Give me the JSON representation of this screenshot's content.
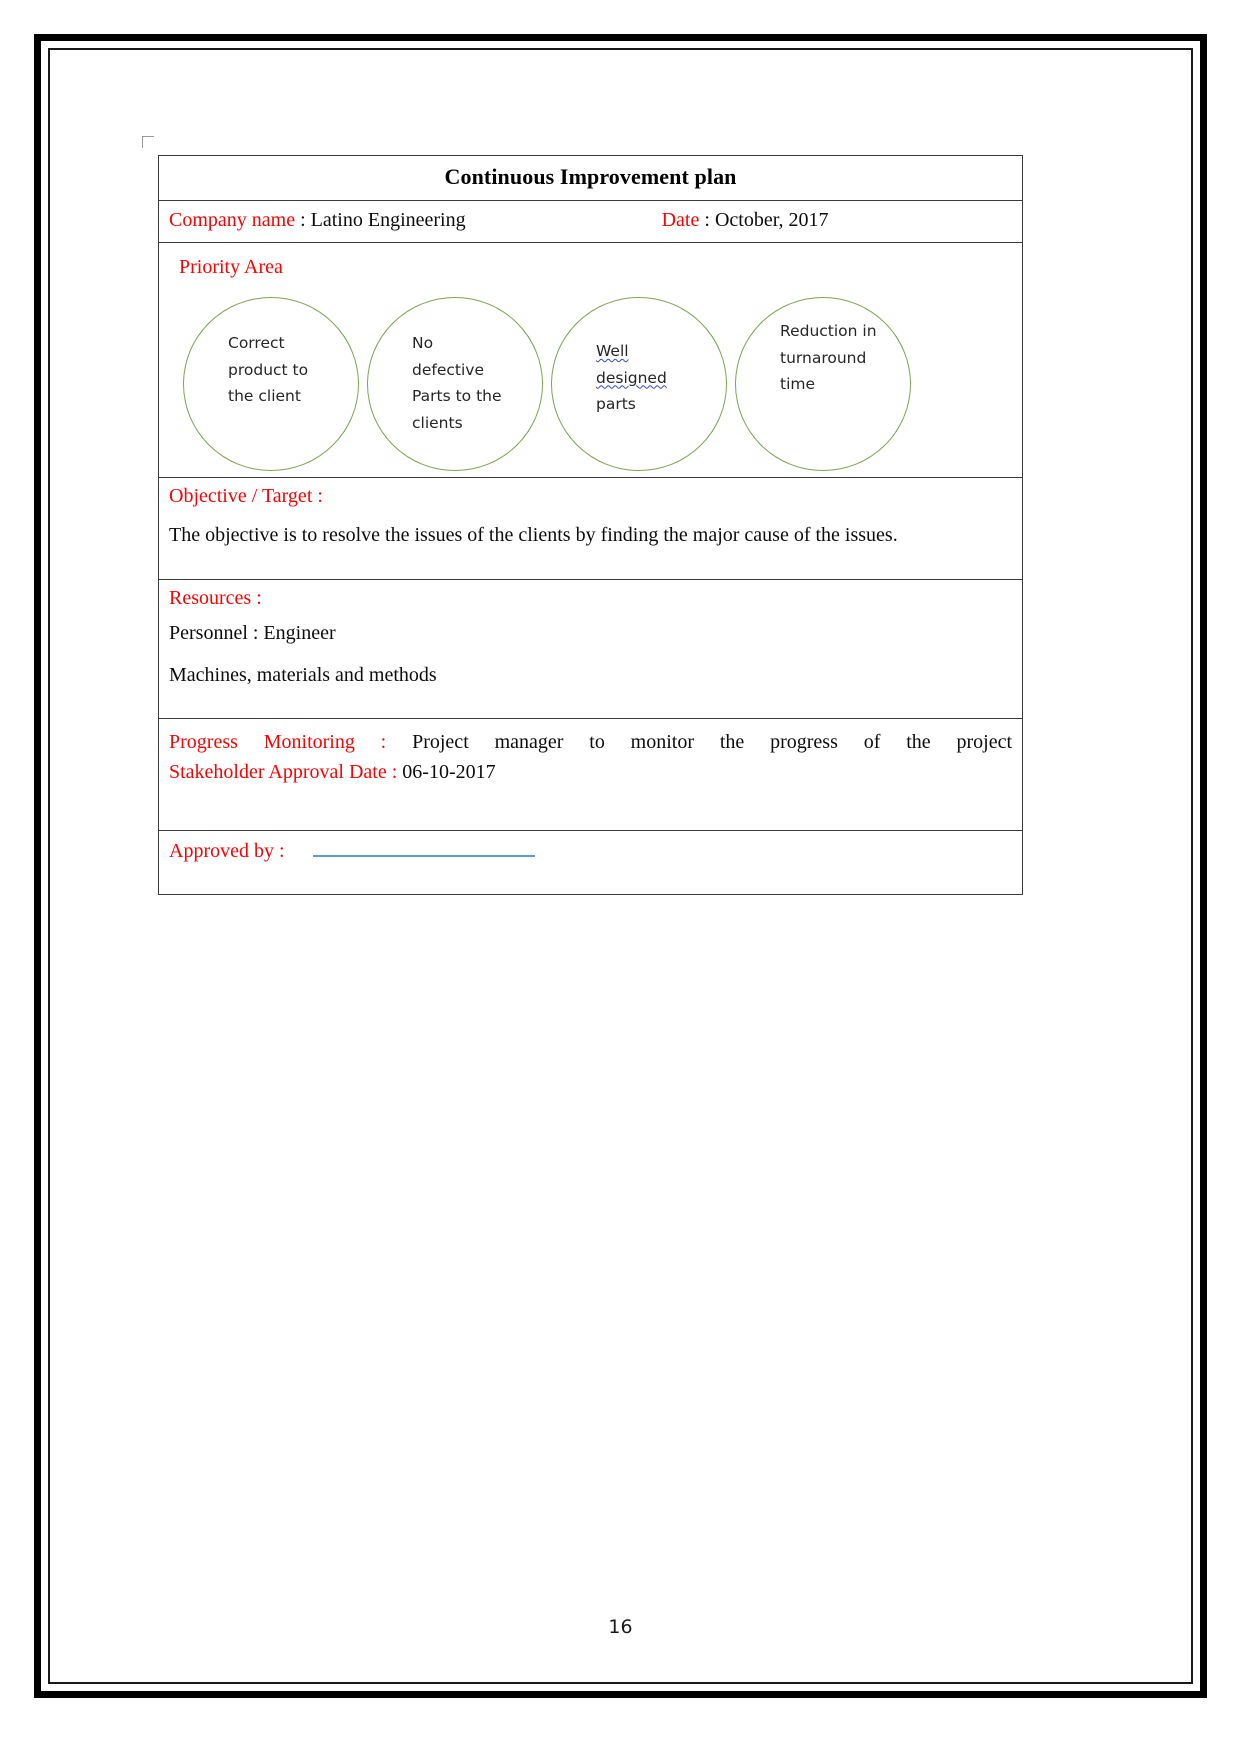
{
  "document": {
    "page_number": "16",
    "title": "Continuous Improvement plan"
  },
  "header": {
    "company_label": "Company name",
    "company_separator": " : ",
    "company_value": "Latino Engineering",
    "date_label": "Date",
    "date_separator": " : ",
    "date_value": "October, 2017"
  },
  "priority_area": {
    "label": "Priority Area",
    "circles": [
      {
        "lines": [
          "Correct",
          "product to",
          "the client"
        ],
        "misspelled": []
      },
      {
        "lines": [
          "No",
          "defective",
          "Parts to the",
          "clients"
        ],
        "misspelled": []
      },
      {
        "lines": [
          "Well",
          "designed",
          "parts"
        ],
        "misspelled": [
          "Well",
          "designed"
        ]
      },
      {
        "lines": [
          "Reduction in",
          "turnaround",
          "time"
        ],
        "misspelled": []
      }
    ]
  },
  "objective": {
    "label": "Objective / Target :",
    "text": "The objective is to resolve the issues of the clients by finding the major cause of the issues."
  },
  "resources": {
    "label": "Resources :",
    "personnel_line": "Personnel : Engineer",
    "other_line": "Machines, materials and methods"
  },
  "progress": {
    "monitoring_label": "Progress Monitoring",
    "monitoring_separator": " : ",
    "monitoring_value": "Project manager to monitor the progress of the project",
    "approval_label": "Stakeholder Approval Date",
    "approval_separator": " : ",
    "approval_value": "06-10-2017"
  },
  "approved": {
    "label": "Approved by :"
  },
  "colors": {
    "label_red": "#ff0000",
    "circle_green": "#7aa84f",
    "signature_blue": "#5b9bd5",
    "spellcheck_blue": "#2b49d6",
    "body_black": "#0d0d0d"
  }
}
